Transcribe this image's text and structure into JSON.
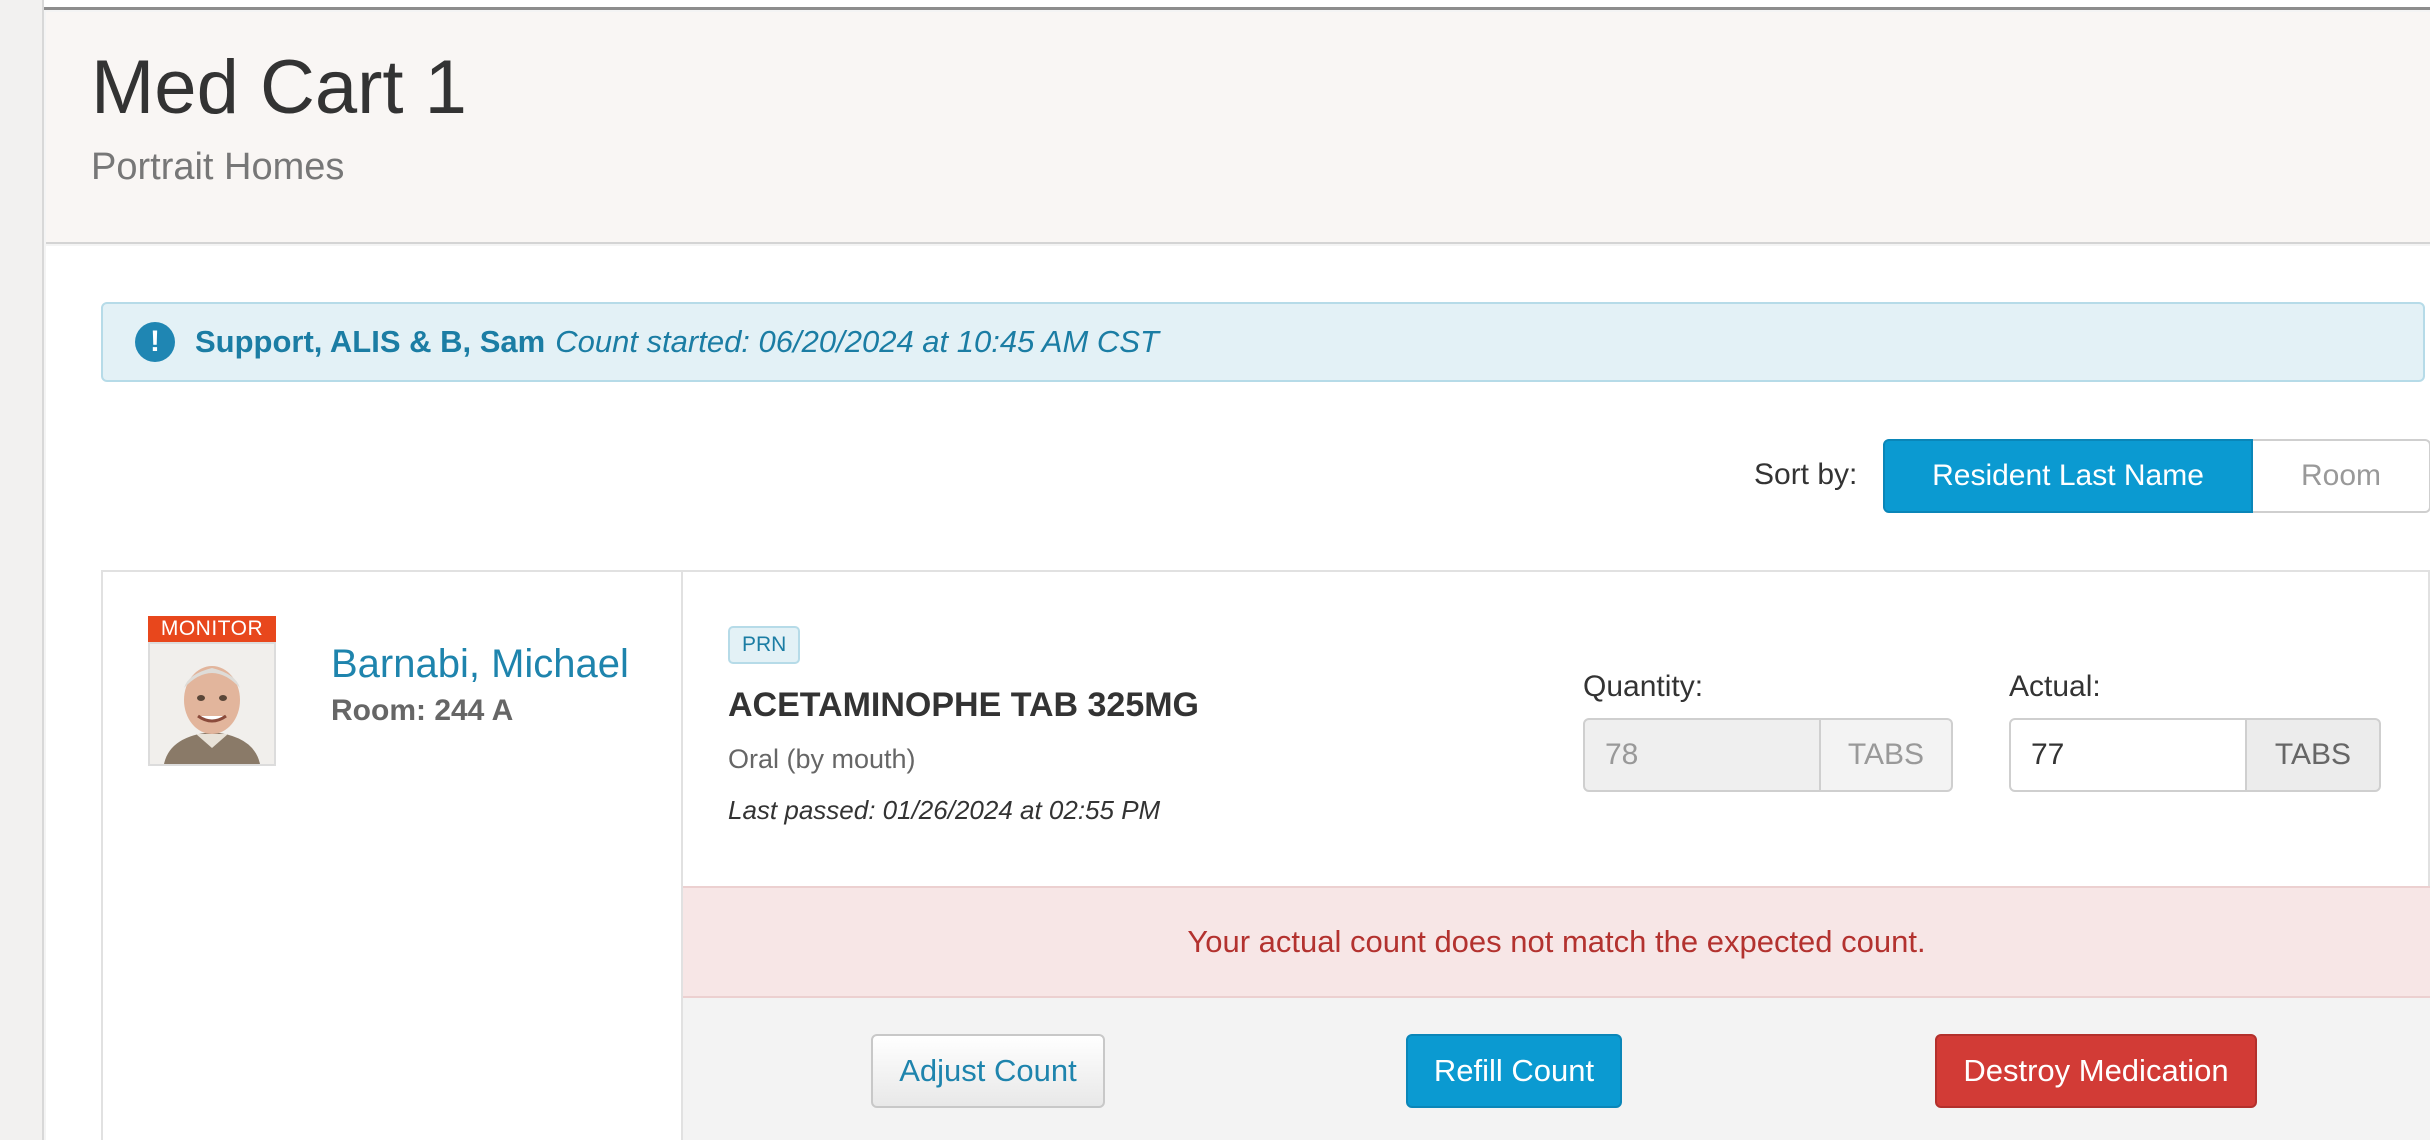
{
  "header": {
    "title": "Med Cart 1",
    "subtitle": "Portrait Homes"
  },
  "alert": {
    "icon": "exclamation-icon",
    "name": "Support, ALIS & B, Sam",
    "started": "Count started: 06/20/2024 at 10:45 AM CST"
  },
  "sort": {
    "label": "Sort by:",
    "options": [
      "Resident Last Name",
      "Room"
    ],
    "selected": "Resident Last Name"
  },
  "resident": {
    "badge": "MONITOR",
    "name": "Barnabi, Michael",
    "room": "Room: 244 A"
  },
  "medication": {
    "badge": "PRN",
    "name": "ACETAMINOPHE TAB 325MG",
    "route": "Oral (by mouth)",
    "last_passed": "Last passed: 01/26/2024 at 02:55 PM",
    "quantity_label": "Quantity:",
    "quantity_value": "78",
    "quantity_unit": "TABS",
    "actual_label": "Actual:",
    "actual_value": "77",
    "actual_unit": "TABS"
  },
  "warning": {
    "text": "Your actual count does not match the expected count."
  },
  "actions": {
    "adjust": "Adjust Count",
    "refill": "Refill Count",
    "destroy": "Destroy Medication"
  },
  "colors": {
    "primary": "#0b9ad1",
    "danger": "#d23b36",
    "monitor": "#e8471c",
    "info_bg": "#e3f1f6",
    "error_bg": "#f7e6e6"
  }
}
